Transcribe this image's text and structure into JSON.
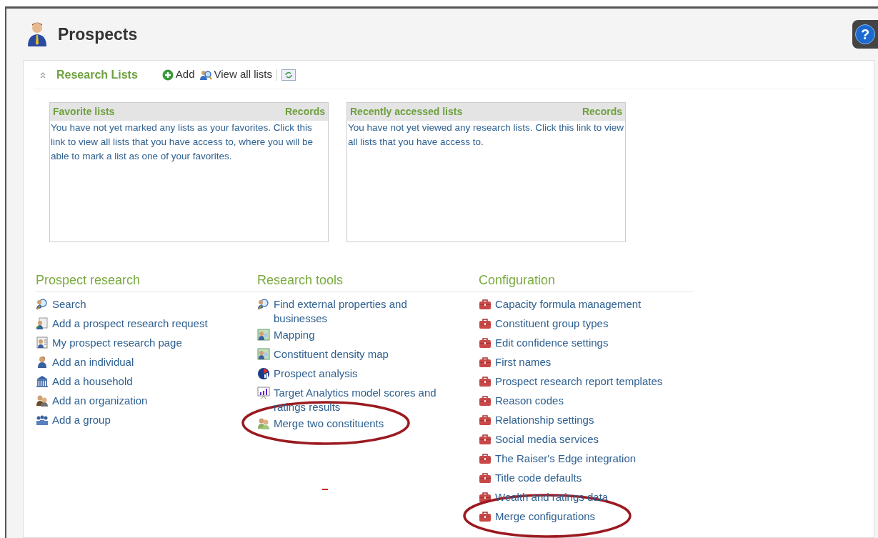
{
  "page": {
    "title": "Prospects",
    "help": "?"
  },
  "research_lists": {
    "title": "Research Lists",
    "expanded": true,
    "actions": [
      {
        "kind": "add",
        "label": "Add"
      },
      {
        "kind": "view",
        "label": "View all lists"
      },
      {
        "kind": "refresh"
      }
    ],
    "boxes": [
      {
        "title": "Favorite lists",
        "column": "Records",
        "message": "You have not yet marked any lists as your favorites. Click this link to view all lists that you have access to, where you will be able to mark a list as one of your favorites."
      },
      {
        "title": "Recently accessed lists",
        "column": "Records",
        "message": "You have not yet viewed any research lists. Click this link to view all lists that you have access to."
      }
    ]
  },
  "sections": [
    {
      "title": "Prospect research",
      "items": [
        {
          "kind": "search",
          "label": "Search",
          "circled": false
        },
        {
          "kind": "request",
          "label": "Add a prospect research request",
          "circled": false
        },
        {
          "kind": "page",
          "label": "My prospect research page",
          "circled": false
        },
        {
          "kind": "individual",
          "label": "Add an individual",
          "circled": false
        },
        {
          "kind": "household",
          "label": "Add a household",
          "circled": false
        },
        {
          "kind": "organization",
          "label": "Add an organization",
          "circled": false
        },
        {
          "kind": "group",
          "label": "Add a group",
          "circled": false
        }
      ]
    },
    {
      "title": "Research tools",
      "items": [
        {
          "kind": "search",
          "label": "Find external properties and businesses",
          "circled": false
        },
        {
          "kind": "map",
          "label": "Mapping",
          "circled": false
        },
        {
          "kind": "map",
          "label": "Constituent density map",
          "circled": false
        },
        {
          "kind": "analysis",
          "label": "Prospect analysis",
          "circled": false
        },
        {
          "kind": "chart",
          "label": "Target Analytics model scores and ratings results",
          "circled": false
        },
        {
          "kind": "merge",
          "label": "Merge two constituents",
          "circled": true
        }
      ]
    },
    {
      "title": "Configuration",
      "items": [
        {
          "kind": "config",
          "label": "Capacity formula management",
          "circled": false
        },
        {
          "kind": "config",
          "label": "Constituent group types",
          "circled": false
        },
        {
          "kind": "config",
          "label": "Edit confidence settings",
          "circled": false
        },
        {
          "kind": "config",
          "label": "First names",
          "circled": false
        },
        {
          "kind": "config",
          "label": "Prospect research report templates",
          "circled": false
        },
        {
          "kind": "config",
          "label": "Reason codes",
          "circled": false
        },
        {
          "kind": "config",
          "label": "Relationship settings",
          "circled": false
        },
        {
          "kind": "config",
          "label": "Social media services",
          "circled": false
        },
        {
          "kind": "config",
          "label": "The Raiser's Edge integration",
          "circled": false
        },
        {
          "kind": "config",
          "label": "Title code defaults",
          "circled": false
        },
        {
          "kind": "config",
          "label": "Wealth and ratings data",
          "circled": false
        },
        {
          "kind": "config",
          "label": "Merge configurations",
          "circled": true
        }
      ]
    }
  ]
}
